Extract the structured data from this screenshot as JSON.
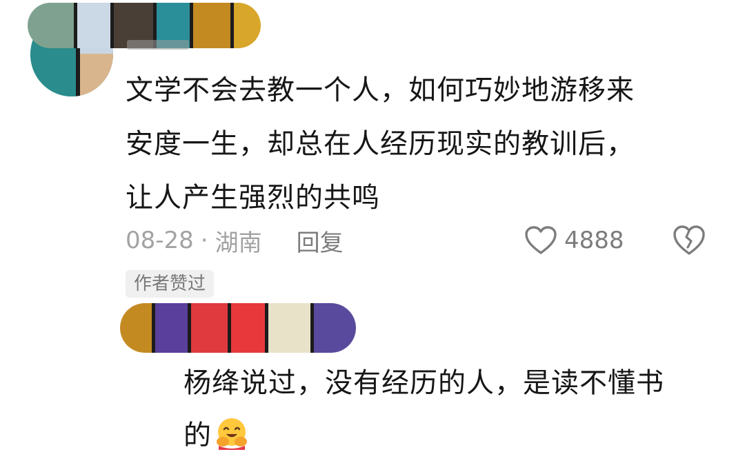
{
  "comment": {
    "text_line_1": "文学不会去教一个人，如何巧妙地游移来",
    "text_line_2": "安度一生，却总在人经历现实的教训后，",
    "text_line_3": "让人产生强烈的共鸣",
    "date": "08-28",
    "separator": "·",
    "location": "湖南",
    "reply_label": "回复",
    "like_count": "4888",
    "author_liked_badge": "作者赞过",
    "like_icon": "heart-outline-icon",
    "dislike_icon": "broken-heart-icon"
  },
  "reply": {
    "text_line_1": "杨绛说过，没有经历的人，是读不懂书",
    "text_line_2": "的",
    "emoji": "hugging-face-emoji"
  },
  "colors": {
    "text": "#161616",
    "meta": "#a2a2a2",
    "action": "#7c7c7c",
    "badge_bg": "#f0f0f0"
  }
}
